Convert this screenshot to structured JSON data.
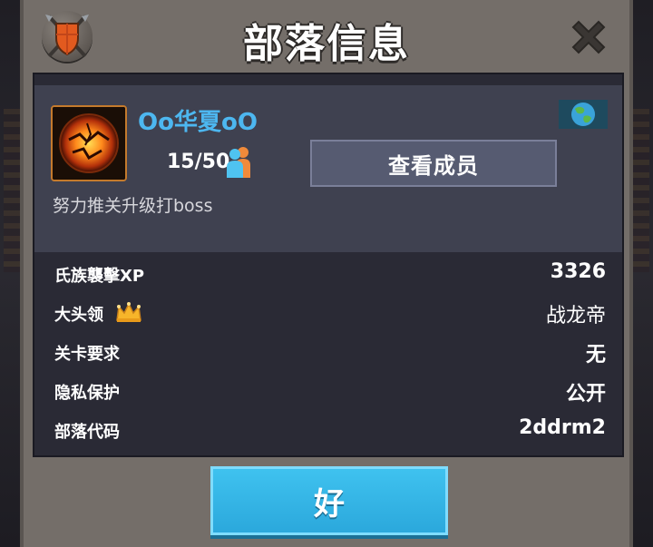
{
  "dialog": {
    "title": "部落信息",
    "ok_label": "好"
  },
  "clan": {
    "name": "Oo华夏oO",
    "members": "15/50",
    "view_members_label": "查看成员",
    "description": "努力推关升级打boss"
  },
  "info": {
    "rows": [
      {
        "label": "氏族襲擊XP",
        "value": "3326"
      },
      {
        "label": "大头领",
        "value": "战龙帝"
      },
      {
        "label": "关卡要求",
        "value": "无"
      },
      {
        "label": "隐私保护",
        "value": "公开"
      },
      {
        "label": "部落代码",
        "value": "2ddrm2"
      }
    ]
  },
  "icons": {
    "emblem": "clan-shield-icon",
    "close": "close-icon",
    "avatar": "lava-orb-icon",
    "members": "members-icon",
    "flag": "globe-flag-icon",
    "crown": "crown-icon"
  },
  "colors": {
    "accent_blue": "#4db7f0",
    "ok_button": "#3fc2ef",
    "panel_dark": "#2a2a35",
    "panel_top": "#3f4150",
    "dialog_frame": "#746e69"
  }
}
